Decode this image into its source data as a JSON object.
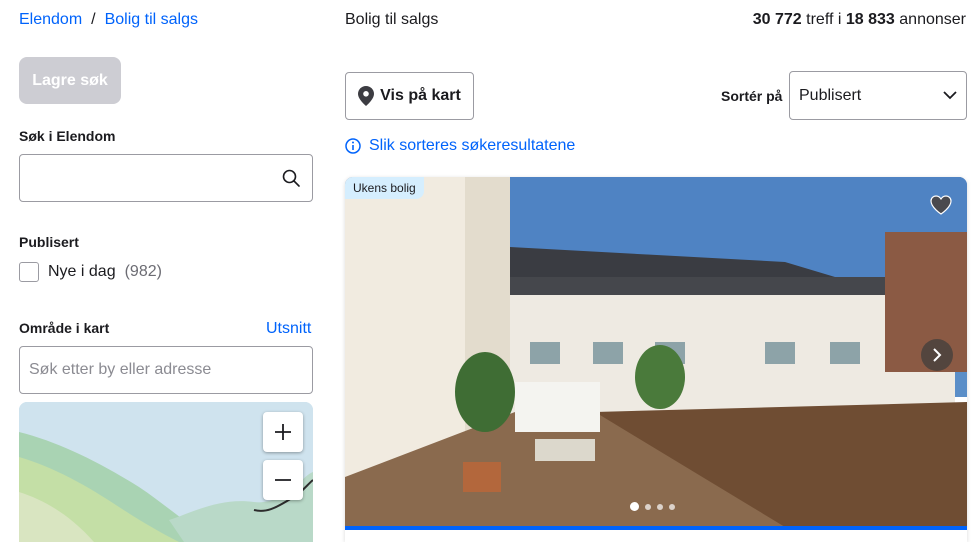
{
  "breadcrumb": {
    "root": "Elendom",
    "separator": "/",
    "current": "Bolig til salgs"
  },
  "sidebar": {
    "save_search_label": "Lagre søk",
    "search_label": "Søk i Elendom",
    "published_label": "Publisert",
    "published_option": {
      "label": "Nye i dag",
      "count": "(982)"
    },
    "area_label": "Område i kart",
    "area_link": "Utsnitt",
    "address_placeholder": "Søk etter by eller adresse"
  },
  "results": {
    "title": "Bolig til salgs",
    "hits": "30 772",
    "hits_text": "treff i",
    "ads": "18 833",
    "ads_text": "annonser",
    "map_button": "Vis på kart",
    "sort_label": "Sortér på",
    "sort_value": "Publisert",
    "sort_info": "Slik sorteres søkeresultatene",
    "listing": {
      "badge": "Ukens bolig",
      "image_dots": 4,
      "active_dot": 1
    }
  },
  "colors": {
    "link": "#0063fb",
    "disabled_button": "#cdcdd3",
    "badge": "#d5eefe"
  }
}
